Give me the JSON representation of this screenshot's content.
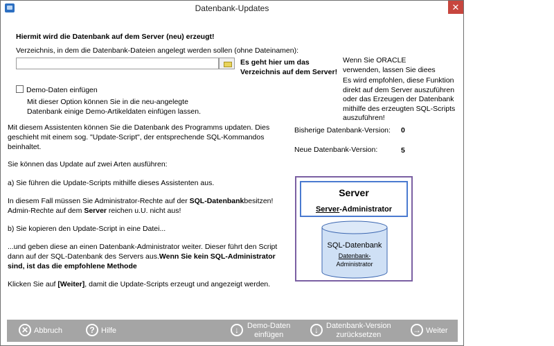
{
  "window": {
    "title": "Datenbank-Updates",
    "close_label": "✕"
  },
  "create": {
    "heading": "Hiermit wird die Datenbank auf dem Server (neu) erzeugt!",
    "dir_label": "Verzeichnis, in dem die Datenbank-Dateien angelegt werden sollen (ohne Dateinamen):",
    "dir_value": "",
    "server_note_line1": "Es geht hier um das",
    "server_note_line2": "Verzeichnis auf dem Server!",
    "oracle_note": [
      "Wenn Sie ORACLE",
      "verwenden, lassen Sie diees",
      "Es wird empfohlen, diese Funktion",
      "direkt auf dem Server auszuführen",
      "oder das Erzeugen der Datenbank",
      "mithilfe des erzeugten SQL-Scripts",
      "auszuführen!"
    ],
    "demo_checkbox_label": "Demo-Daten einfügen",
    "demo_checked": false,
    "demo_desc_line1": "Mit dieser Option können Sie in die neu-angelegte",
    "demo_desc_line2": "Datenbank einige Demo-Artikeldaten einfügen lassen."
  },
  "info": {
    "intro_line1": "Mit diesem Assistenten können Sie die Datenbank des Programms updaten. Dies",
    "intro_line2": "geschieht mit einem sog. \"Update-Script\", der entsprechende SQL-Kommandos",
    "intro_line3": "beinhaltet.",
    "ways": "Sie können das Update auf zwei Arten ausführen:",
    "option_a": "a) Sie führen die Update-Scripts mithilfe dieses Assistenten aus.",
    "rights_pre": "In diesem Fall müssen Sie Administrator-Rechte auf der ",
    "rights_bold": "SQL-Datenbank",
    "rights_post": "besitzen!",
    "admin_pre": "Admin-Rechte auf dem ",
    "admin_bold": "Server",
    "admin_post": " reichen u.U. nicht aus!",
    "option_b": "b) Sie kopieren den Update-Script in eine Datei...",
    "forward_line1": "...und geben diese an einen Datenbank-Administrator weiter. Dieser führt den Script",
    "forward_line2_pre": "dann auf der SQL-Datenbank des Servers aus.",
    "forward_line2_bold": "Wenn Sie kein SQL-Administrator",
    "forward_line3_bold": "sind, ist das die empfohlene Methode",
    "click_pre": "Klicken Sie auf ",
    "click_bold": "[Weiter]",
    "click_post": ", damit die Update-Scripts erzeugt und angezeigt werden."
  },
  "versions": {
    "current_label": "Bisherige Datenbank-Version:",
    "current_value": "0",
    "new_label": "Neue Datenbank-Version:",
    "new_value": "5"
  },
  "diagram": {
    "server_title": "Server",
    "server_sub_underlined": "Server",
    "server_sub_rest": "-Administrator",
    "db_title": "SQL-Datenbank",
    "db_sub_line1": "Datenbank-",
    "db_sub_line2": "Administrator"
  },
  "footer": {
    "cancel": "Abbruch",
    "help": "Hilfe",
    "demo_line1": "Demo-Daten",
    "demo_line2": "einfügen",
    "reset_line1": "Datenbank-Version",
    "reset_line2": "zurücksetzen",
    "next": "Weiter"
  },
  "colors": {
    "footer_bg": "#a5a5a5",
    "close_bg": "#c7463e",
    "diagram_border": "#7a5fa2",
    "server_border": "#4a7ad0",
    "db_fill": "#cfe0f5"
  },
  "icons": {
    "app": "app-icon",
    "cancel": "cancel-icon",
    "help": "help-icon",
    "demo": "download-icon",
    "reset": "download-icon",
    "next": "arrow-right-icon"
  }
}
